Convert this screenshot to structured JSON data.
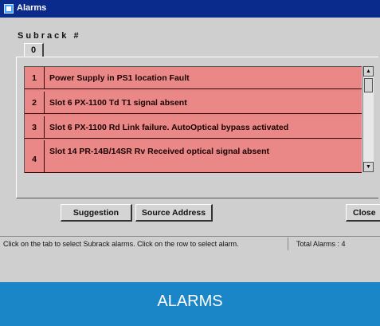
{
  "window": {
    "title": "Alarms"
  },
  "subrack": {
    "label": "Subrack  #",
    "tabs": [
      "0"
    ]
  },
  "alarms": [
    {
      "num": "1",
      "text": "Power Supply in PS1 location  Fault"
    },
    {
      "num": "2",
      "text": "Slot 6  PX-1100 Td  T1 signal absent"
    },
    {
      "num": "3",
      "text": "Slot 6  PX-1100  Rd  Link failure. AutoOptical bypass activated"
    },
    {
      "num": "4",
      "text": "Slot 14  PR-14B/14SR Rv  Received optical signal absent"
    }
  ],
  "buttons": {
    "suggestion": "Suggestion",
    "source_address": "Source Address",
    "close": "Close"
  },
  "status": {
    "message": "Click on the tab to select Subrack alarms. Click on the row to select alarm.",
    "total": "Total Alarms :  4"
  },
  "banner": {
    "text": "ALARMS"
  },
  "colors": {
    "title_bar": "#0a2a8c",
    "alarm_row": "#ea8888",
    "banner": "#1a86c7"
  }
}
